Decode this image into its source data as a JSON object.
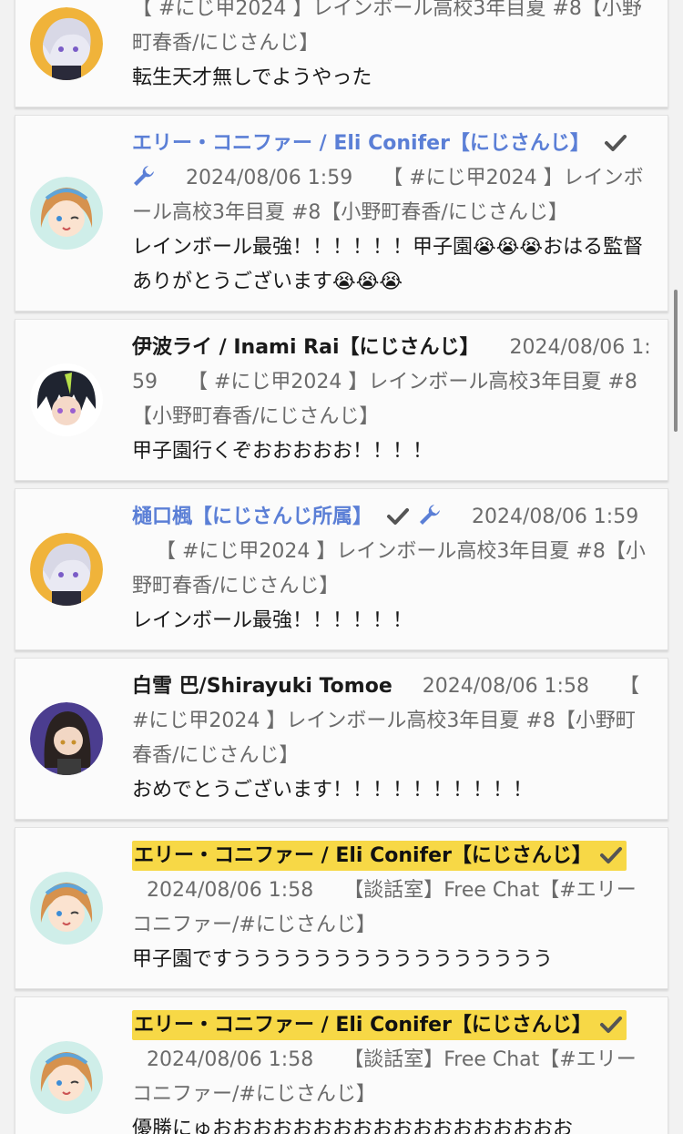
{
  "messages": [
    {
      "author": "",
      "author_style": "none",
      "badges": [],
      "timestamp": "",
      "context": "【 #にじ甲2024 】レインボール高校3年目夏 #8【小野町春香/にじさんじ】",
      "text": "転生天才無しでようやった",
      "avatar": "silver-hair-avatar"
    },
    {
      "author": "エリー・コニファー / Eli Conifer【にじさんじ】",
      "author_style": "member",
      "badges": [
        "check-icon",
        "wrench-icon"
      ],
      "timestamp": "2024/08/06 1:59",
      "context": "【 #にじ甲2024 】レインボール高校3年目夏 #8【小野町春香/にじさんじ】",
      "text": "レインボール最強！！！！！！甲子園😭😭😭おはる監督ありがとうございます😭😭😭",
      "avatar": "blonde-winking-avatar"
    },
    {
      "author": "伊波ライ / Inami Rai【にじさんじ】",
      "author_style": "plain",
      "badges": [],
      "timestamp": "2024/08/06 1:59",
      "context": "【 #にじ甲2024 】レインボール高校3年目夏 #8【小野町春香/にじさんじ】",
      "text": "甲子園行くぞおおおおお！！！！",
      "avatar": "dark-hair-avatar"
    },
    {
      "author": "樋口楓【にじさんじ所属】",
      "author_style": "member",
      "badges": [
        "check-icon",
        "wrench-icon"
      ],
      "timestamp": "2024/08/06 1:59",
      "context": "【 #にじ甲2024 】レインボール高校3年目夏 #8【小野町春香/にじさんじ】",
      "text": "レインボール最強！！！！！！",
      "avatar": "silver-hair-avatar"
    },
    {
      "author": "白雪 巴/Shirayuki Tomoe",
      "author_style": "plain",
      "badges": [],
      "timestamp": "2024/08/06 1:58",
      "context": "【 #にじ甲2024 】レインボール高校3年目夏 #8【小野町春香/にじさんじ】",
      "text": "おめでとうございます！！！！！！！！！！",
      "avatar": "purple-bg-avatar"
    },
    {
      "author": "エリー・コニファー / Eli Conifer【にじさんじ】",
      "author_style": "chip",
      "badges": [
        "check-icon"
      ],
      "timestamp": "2024/08/06 1:58",
      "context": "【談話室】Free Chat【#エリーコニファー/#にじさんじ】",
      "text": "甲子園ですうううううううううううううううう",
      "avatar": "blonde-winking-avatar"
    },
    {
      "author": "エリー・コニファー / Eli Conifer【にじさんじ】",
      "author_style": "chip",
      "badges": [
        "check-icon"
      ],
      "timestamp": "2024/08/06 1:58",
      "context": "【談話室】Free Chat【#エリーコニファー/#にじさんじ】",
      "text": "優勝にゅおおおおおおおおおおおおおおおおおお",
      "avatar": "blonde-winking-avatar"
    }
  ],
  "colors": {
    "member_name": "#5b7fd6",
    "highlight_chip": "#f7d846",
    "meta_text": "#6b6b6b"
  }
}
